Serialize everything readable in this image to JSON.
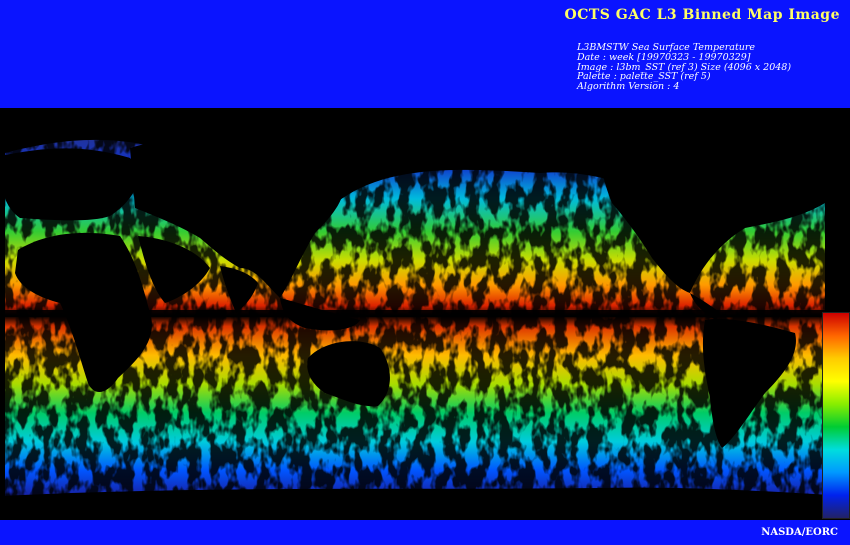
{
  "header": {
    "title": "OCTS GAC L3 Binned Map Image",
    "info_lines": [
      "L3BMSTW Sea Surface Temperature",
      "Date : week [19970323 - 19970329]",
      "Image : l3bm_SST (ref 3) Size (4096 x 2048)",
      "Palette : palette_SST (ref 5)",
      "Algorithm Version : 4"
    ]
  },
  "footer": {
    "credit": "NASDA/EORC"
  },
  "colors": {
    "banner": "#0a14ff",
    "title_text": "#ffff66",
    "map_background": "#000000",
    "land_mask": "#000000"
  },
  "legend": {
    "type": "continuous-colorbar",
    "palette_stops": [
      "#cc0000",
      "#ff6600",
      "#ffcc00",
      "#ffff00",
      "#88ee00",
      "#00cc33",
      "#00dddd",
      "#0099ff",
      "#0022ee",
      "#222266"
    ]
  }
}
